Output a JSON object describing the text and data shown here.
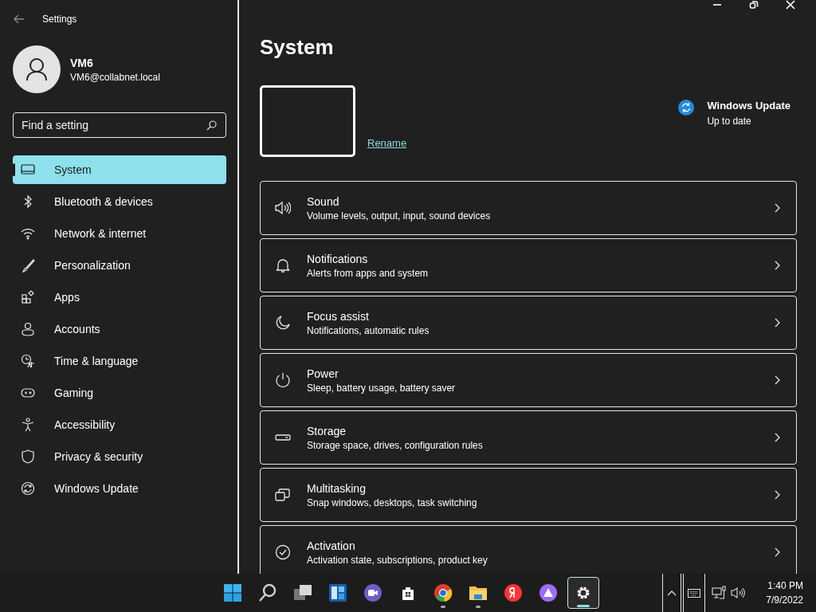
{
  "window": {
    "title": "Settings"
  },
  "account": {
    "name": "VM6",
    "email": "VM6@collabnet.local"
  },
  "search": {
    "placeholder": "Find a setting"
  },
  "sidebar": {
    "items": [
      {
        "label": "System",
        "selected": true
      },
      {
        "label": "Bluetooth & devices",
        "selected": false
      },
      {
        "label": "Network & internet",
        "selected": false
      },
      {
        "label": "Personalization",
        "selected": false
      },
      {
        "label": "Apps",
        "selected": false
      },
      {
        "label": "Accounts",
        "selected": false
      },
      {
        "label": "Time & language",
        "selected": false
      },
      {
        "label": "Gaming",
        "selected": false
      },
      {
        "label": "Accessibility",
        "selected": false
      },
      {
        "label": "Privacy & security",
        "selected": false
      },
      {
        "label": "Windows Update",
        "selected": false
      }
    ]
  },
  "page": {
    "title": "System",
    "rename_link": "Rename",
    "update": {
      "title": "Windows Update",
      "status": "Up to date"
    }
  },
  "settings": [
    {
      "title": "Sound",
      "description": "Volume levels, output, input, sound devices"
    },
    {
      "title": "Notifications",
      "description": "Alerts from apps and system"
    },
    {
      "title": "Focus assist",
      "description": "Notifications, automatic rules"
    },
    {
      "title": "Power",
      "description": "Sleep, battery usage, battery saver"
    },
    {
      "title": "Storage",
      "description": "Storage space, drives, configuration rules"
    },
    {
      "title": "Multitasking",
      "description": "Snap windows, desktops, task switching"
    },
    {
      "title": "Activation",
      "description": "Activation state, subscriptions, product key"
    }
  ],
  "taskbar": {
    "apps": [
      {
        "running": false,
        "selected": false
      },
      {
        "running": false,
        "selected": false
      },
      {
        "running": false,
        "selected": false
      },
      {
        "running": false,
        "selected": false
      },
      {
        "running": false,
        "selected": false
      },
      {
        "running": false,
        "selected": false
      },
      {
        "running": true,
        "selected": false
      },
      {
        "running": true,
        "selected": false
      },
      {
        "running": false,
        "selected": false
      },
      {
        "running": false,
        "selected": false
      },
      {
        "running": true,
        "selected": true
      }
    ],
    "time": "1:40 PM",
    "date": "7/9/2022"
  }
}
